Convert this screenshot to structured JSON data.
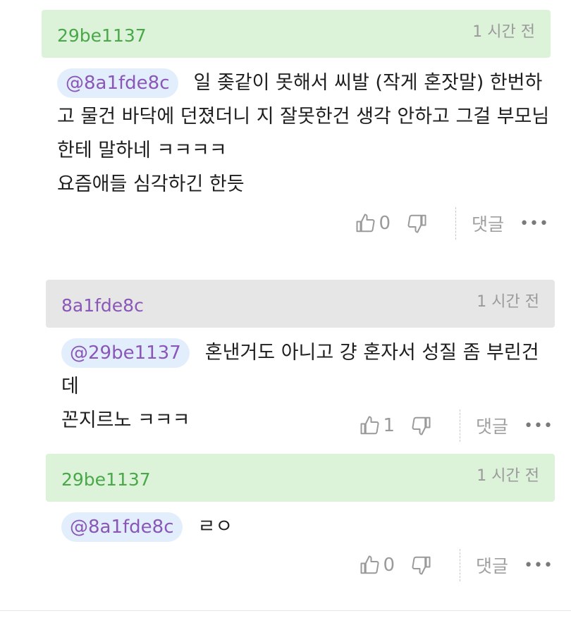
{
  "comments": [
    {
      "username": "29be1137",
      "time": "1 시간 전",
      "mention": "@8a1fde8c",
      "text": "일 좆같이 못해서 씨발 (작게 혼잣말) 한번하",
      "lines": [
        "고 물건 바닥에 던졌더니 지 잘못한건 생각 안하고 그걸 부모님",
        "한테 말하네 ㅋㅋㅋㅋ",
        "요즘애들 심각하긴 한듯"
      ],
      "likes": "0",
      "reply_label": "댓글",
      "more_label": "•••"
    },
    {
      "username": "8a1fde8c",
      "time": "1 시간 전",
      "mention": "@29be1137",
      "text": "혼낸거도 아니고 걍 혼자서 성질 좀 부린건데",
      "lines": [
        "꼰지르노 ㅋㅋㅋ"
      ],
      "likes": "1",
      "reply_label": "댓글",
      "more_label": "•••"
    },
    {
      "username": "29be1137",
      "time": "1 시간 전",
      "mention": "@8a1fde8c",
      "text": "ㄹㅇ",
      "lines": [],
      "likes": "0",
      "reply_label": "댓글",
      "more_label": "•••"
    }
  ],
  "colors": {
    "green_header": "#dcf3d9",
    "gray_header": "#e6e6e6",
    "green_name": "#4aa84a",
    "purple_name": "#8a57b8",
    "mention_bg": "#e3eefc"
  },
  "icons": [
    "thumbs-up-icon",
    "thumbs-down-icon",
    "more-icon"
  ]
}
